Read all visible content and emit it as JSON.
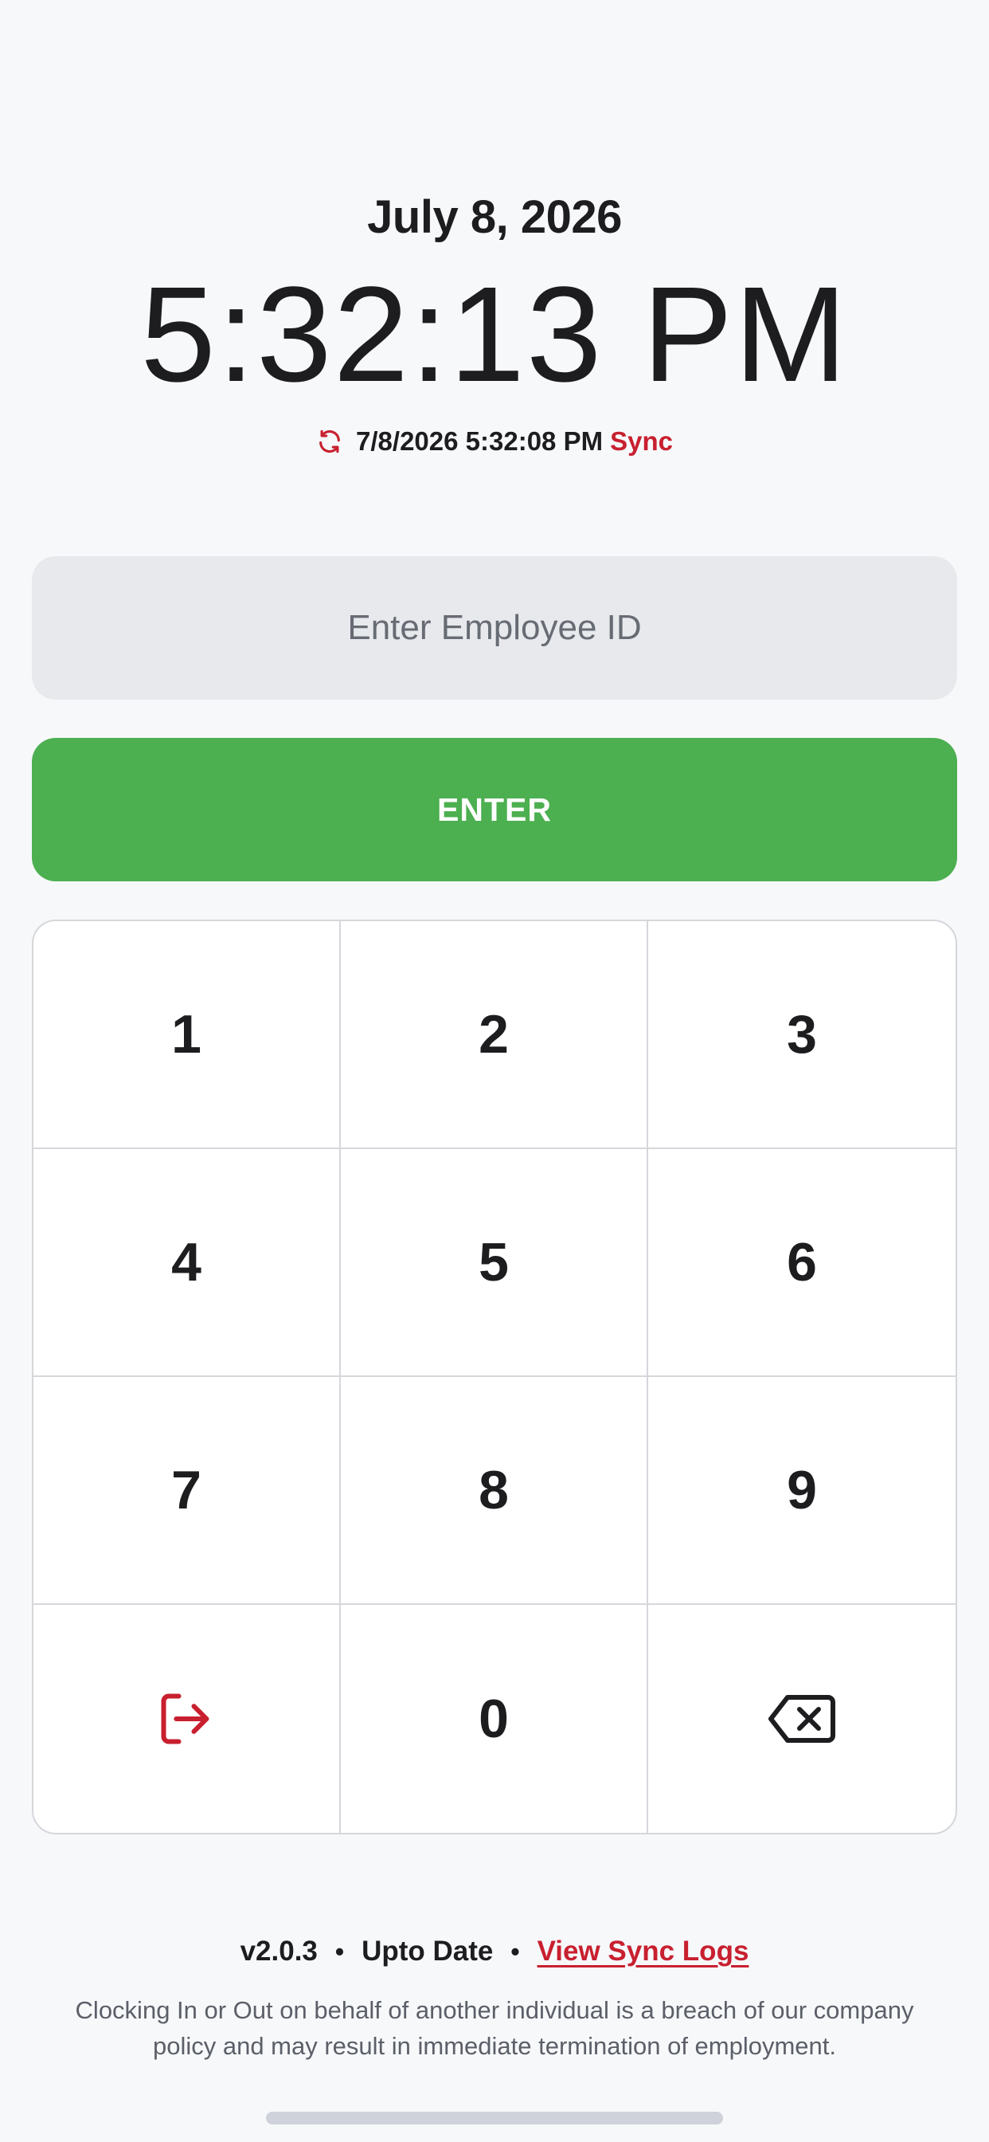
{
  "header": {
    "date": "July 8, 2026",
    "time": "5:32:13 PM"
  },
  "sync": {
    "icon": "sync-icon",
    "last_sync": "7/8/2026 5:32:08 PM",
    "action_label": "Sync",
    "accent_color": "#c8202f"
  },
  "employee_input": {
    "value": "",
    "placeholder": "Enter Employee ID"
  },
  "enter_button": {
    "label": "ENTER",
    "color": "#4caf50"
  },
  "keypad": {
    "keys": [
      "1",
      "2",
      "3",
      "4",
      "5",
      "6",
      "7",
      "8",
      "9"
    ],
    "zero": "0",
    "left_icon": "logout-icon",
    "right_icon": "backspace-icon"
  },
  "footer": {
    "version": "v2.0.3",
    "separator": "•",
    "status": "Upto Date",
    "logs_link": "View Sync Logs",
    "disclaimer": "Clocking In or Out on behalf of another individual is a breach of our company policy and may result in immediate termination of employment."
  }
}
